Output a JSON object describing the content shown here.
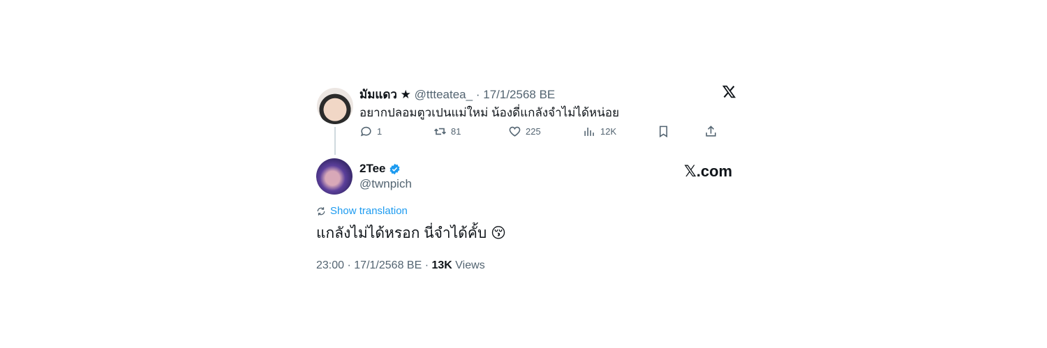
{
  "reply": {
    "display_name": "มัมแดว ★",
    "handle": "@ttteatea_",
    "separator": "·",
    "date": "17/1/2568 BE",
    "text": "อยากปลอมตูวเปนแม่ใหม่ น้องดี่แกลังจำไม่ได้หน่อย",
    "actions": {
      "replies": "1",
      "reposts": "81",
      "likes": "225",
      "views": "12K"
    }
  },
  "main": {
    "display_name": "2Tee",
    "handle": "@twnpich",
    "verified": true,
    "show_translation": "Show translation",
    "text": "แกลังไม่ได้หรอก นี่จำได้คั้บ 😚",
    "time": "23:00",
    "date": "17/1/2568 BE",
    "views_count": "13K",
    "views_label": "Views",
    "sep": "·"
  },
  "branding": {
    "site": "𝕏.com",
    "logo": "x-logo"
  },
  "colors": {
    "accent": "#1d9bf0",
    "muted": "#536471",
    "text": "#0f1419"
  }
}
